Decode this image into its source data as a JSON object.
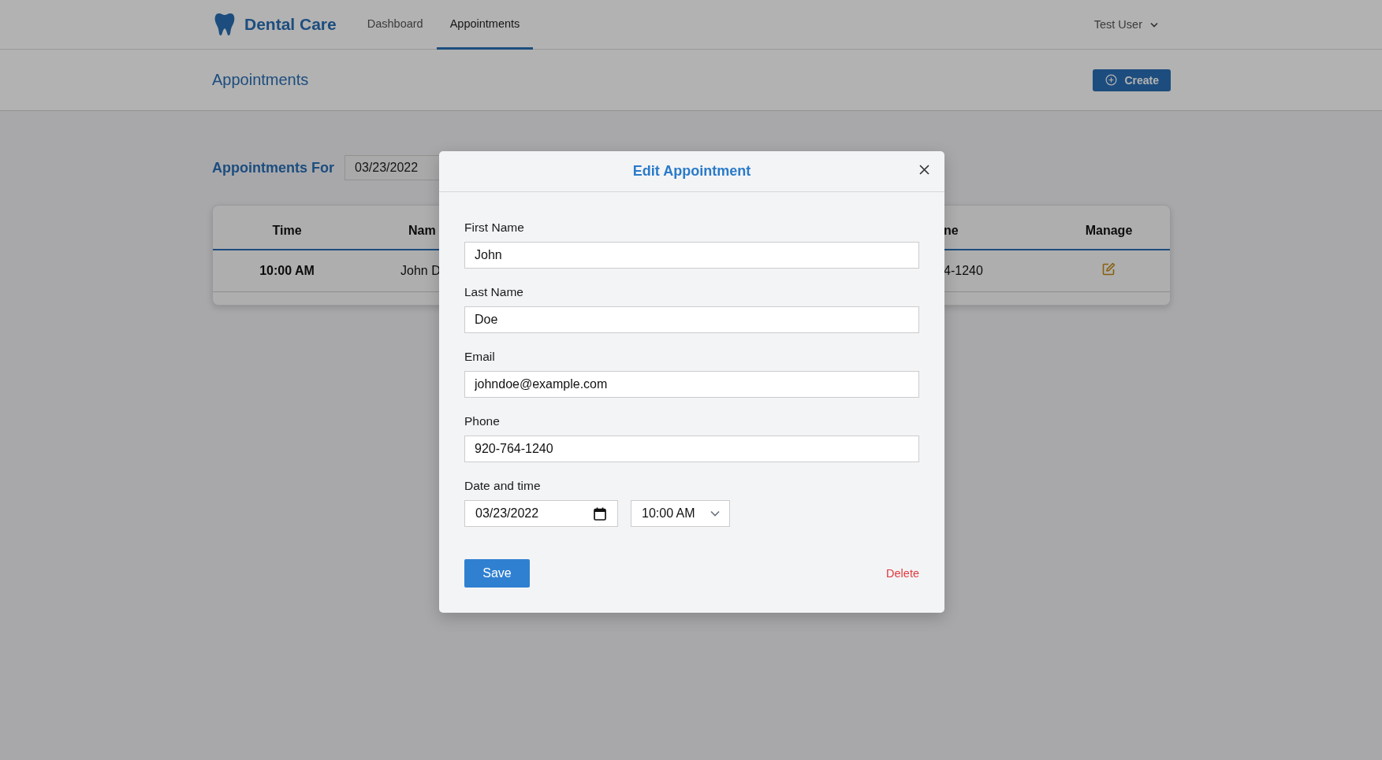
{
  "brand": {
    "name": "Dental Care"
  },
  "nav": [
    {
      "label": "Dashboard",
      "selected": false
    },
    {
      "label": "Appointments",
      "selected": true
    }
  ],
  "user_menu": {
    "label": "Test User"
  },
  "page_header": {
    "title": "Appointments",
    "create_button": "Create"
  },
  "filter": {
    "label": "Appointments For",
    "date": "03/23/2022"
  },
  "table": {
    "columns": [
      "Time",
      "Nam",
      "ne",
      "Manage"
    ],
    "rows": [
      {
        "time": "10:00 AM",
        "name": "John D",
        "phone": "4-1240"
      }
    ]
  },
  "modal": {
    "title": "Edit Appointment",
    "fields": [
      {
        "label": "First Name",
        "value": "John"
      },
      {
        "label": "Last Name",
        "value": "Doe"
      },
      {
        "label": "Email",
        "value": "johndoe@example.com"
      },
      {
        "label": "Phone",
        "value": "920-764-1240"
      }
    ],
    "datetime": {
      "label": "Date and time",
      "date": "03/23/2022",
      "time": "10:00 AM"
    },
    "save_button": "Save",
    "delete_link": "Delete"
  }
}
